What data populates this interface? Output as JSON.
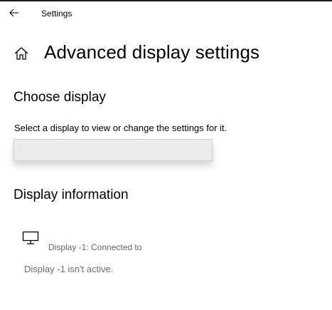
{
  "window": {
    "title": "Settings"
  },
  "icons": {
    "back": "back-arrow-icon",
    "home": "home-icon",
    "monitor": "monitor-icon"
  },
  "page": {
    "title": "Advanced display settings"
  },
  "choose_display": {
    "heading": "Choose display",
    "label": "Select a display to view or change the settings for it.",
    "dropdown_value": ""
  },
  "display_info": {
    "heading": "Display information",
    "connected_text": "Display -1: Connected to",
    "status_text": "Display -1 isn't active."
  },
  "colors": {
    "background": "#ffffff",
    "dropdown_fill": "#ececec",
    "dropdown_border": "#cfcfcf",
    "secondary_text": "#666666"
  }
}
